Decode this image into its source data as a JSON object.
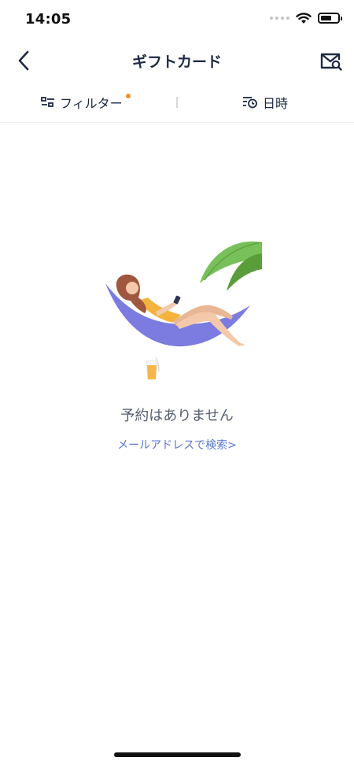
{
  "status_bar": {
    "time": "14:05"
  },
  "nav": {
    "title": "ギフトカード",
    "back_icon": "chevron-left-icon",
    "action_icon": "mail-search-icon"
  },
  "filter_bar": {
    "filter_label": "フィルター",
    "filter_icon": "filter-sliders-icon",
    "filter_dot_color": "#f0922b",
    "date_label": "日時",
    "date_icon": "sort-clock-icon"
  },
  "empty_state": {
    "illustration": "woman-in-hammock-illustration",
    "title": "予約はありません",
    "link": "メールアドレスで検索>"
  },
  "colors": {
    "primary_text": "#1f2a44",
    "link": "#5a78d6",
    "hammock": "#7b7be0",
    "accent": "#f0922b"
  }
}
